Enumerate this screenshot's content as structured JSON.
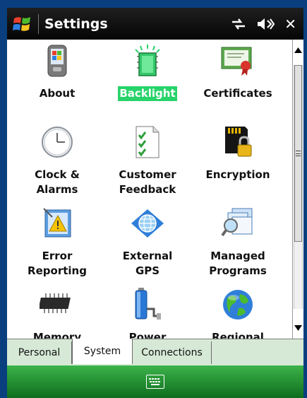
{
  "titlebar": {
    "title": "Settings",
    "close_label": "✕"
  },
  "settings_items": [
    {
      "label": "About",
      "icon": "pda-icon",
      "selected": false
    },
    {
      "label": "Backlight",
      "icon": "backlight-chip-icon",
      "selected": true
    },
    {
      "label": "Certificates",
      "icon": "certificate-icon",
      "selected": false
    },
    {
      "label": "Clock &\nAlarms",
      "icon": "clock-icon",
      "selected": false
    },
    {
      "label": "Customer\nFeedback",
      "icon": "checklist-icon",
      "selected": false
    },
    {
      "label": "Encryption",
      "icon": "sd-card-lock-icon",
      "selected": false
    },
    {
      "label": "Error\nReporting",
      "icon": "warning-icon",
      "selected": false
    },
    {
      "label": "External\nGPS",
      "icon": "gps-globe-icon",
      "selected": false
    },
    {
      "label": "Managed\nPrograms",
      "icon": "managed-programs-icon",
      "selected": false
    },
    {
      "label": "Memory",
      "icon": "memory-chip-icon",
      "selected": false
    },
    {
      "label": "Power",
      "icon": "battery-icon",
      "selected": false
    },
    {
      "label": "Regional\nSettings",
      "icon": "globe-icon",
      "selected": false
    }
  ],
  "tabs": [
    {
      "label": "Personal",
      "active": false
    },
    {
      "label": "System",
      "active": true
    },
    {
      "label": "Connections",
      "active": false
    }
  ],
  "colors": {
    "selection": "#27d36a",
    "titlebar": "#0a0a0a",
    "menubar": "#1f8f30",
    "tabstrip": "#d6e9d6"
  }
}
